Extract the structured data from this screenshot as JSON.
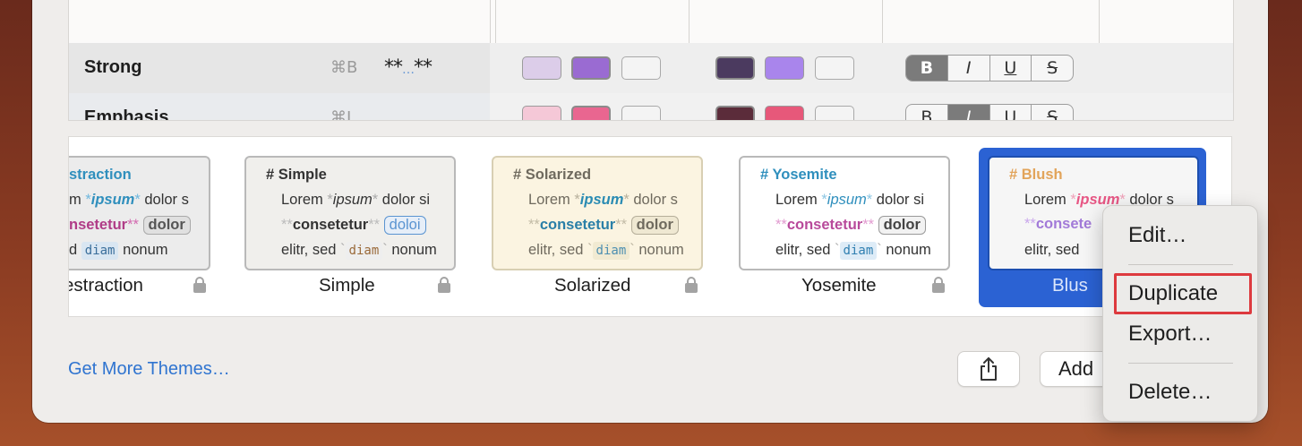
{
  "style_rows": [
    {
      "name": "Strong",
      "shortcut": "⌘B",
      "syntax_pre": "**",
      "syntax_dots": "…",
      "syntax_post": "**",
      "light_colors": [
        "#dccde9",
        "#9a6bd2"
      ],
      "dark_colors": [
        "#4b3a5f",
        "#a985ec"
      ],
      "format_active": "bold"
    },
    {
      "name": "Emphasis",
      "shortcut": "⌘I",
      "light_colors": [
        "#f5c8d7",
        "#e96690"
      ],
      "dark_colors": [
        "#5b2c3a",
        "#e7587a"
      ],
      "format_active": "italic"
    }
  ],
  "format_buttons": [
    "B",
    "I",
    "U",
    "S"
  ],
  "themes": [
    {
      "name": "Abstraction",
      "label_visible": "estraction",
      "header_visible": "straction",
      "locked": true,
      "line1": [
        "m ",
        "*",
        "ipsum",
        "*",
        " dolor s"
      ],
      "line2_strong": "nsetetur",
      "line2_tag": "dolor",
      "line3": [
        "d ",
        "`",
        "diam",
        "`",
        " nonum"
      ]
    },
    {
      "name": "Simple",
      "header": "# Simple",
      "locked": true,
      "line1": [
        "Lorem ",
        "*",
        "ipsum",
        "*",
        " dolor si"
      ],
      "line2_strong": "consetetur",
      "line2_tag": "doloi",
      "line3": [
        "elitr, sed ",
        "`",
        "diam",
        "`",
        " nonum"
      ]
    },
    {
      "name": "Solarized",
      "header": "# Solarized",
      "locked": true,
      "line1": [
        "Lorem ",
        "*",
        "ipsum",
        "*",
        " dolor s"
      ],
      "line2_strong": "consetetur",
      "line2_tag": "dolor",
      "line3": [
        "elitr, sed ",
        "`",
        "diam",
        "`",
        " nonum"
      ]
    },
    {
      "name": "Yosemite",
      "header": "# Yosemite",
      "locked": true,
      "line1": [
        "Lorem ",
        "*",
        "ipsum",
        "*",
        " dolor si"
      ],
      "line2_strong": "consetetur",
      "line2_tag": "dolor",
      "line3": [
        "elitr, sed ",
        "`",
        "diam",
        "`",
        " nonum"
      ]
    },
    {
      "name": "Blush",
      "label_visible": "Blus",
      "header": "# Blush",
      "selected": true,
      "line1": [
        "Lorem ",
        "*",
        "ipsum",
        "*",
        " dolor s"
      ],
      "line2_strong": "consete",
      "line3": [
        "elitr, sed "
      ]
    }
  ],
  "bottom": {
    "get_more_link": "Get More Themes…",
    "add_button_visible": "Add"
  },
  "context_menu": {
    "items": [
      "Edit…",
      "Duplicate",
      "Export…",
      "Delete…"
    ],
    "highlighted": "Duplicate"
  },
  "colors": {
    "selection_blue": "#2b62d3",
    "link_blue": "#2f74d0",
    "highlight_red": "#dd3a3e"
  },
  "icons": {
    "share": "share-icon",
    "lock": "lock-icon"
  }
}
